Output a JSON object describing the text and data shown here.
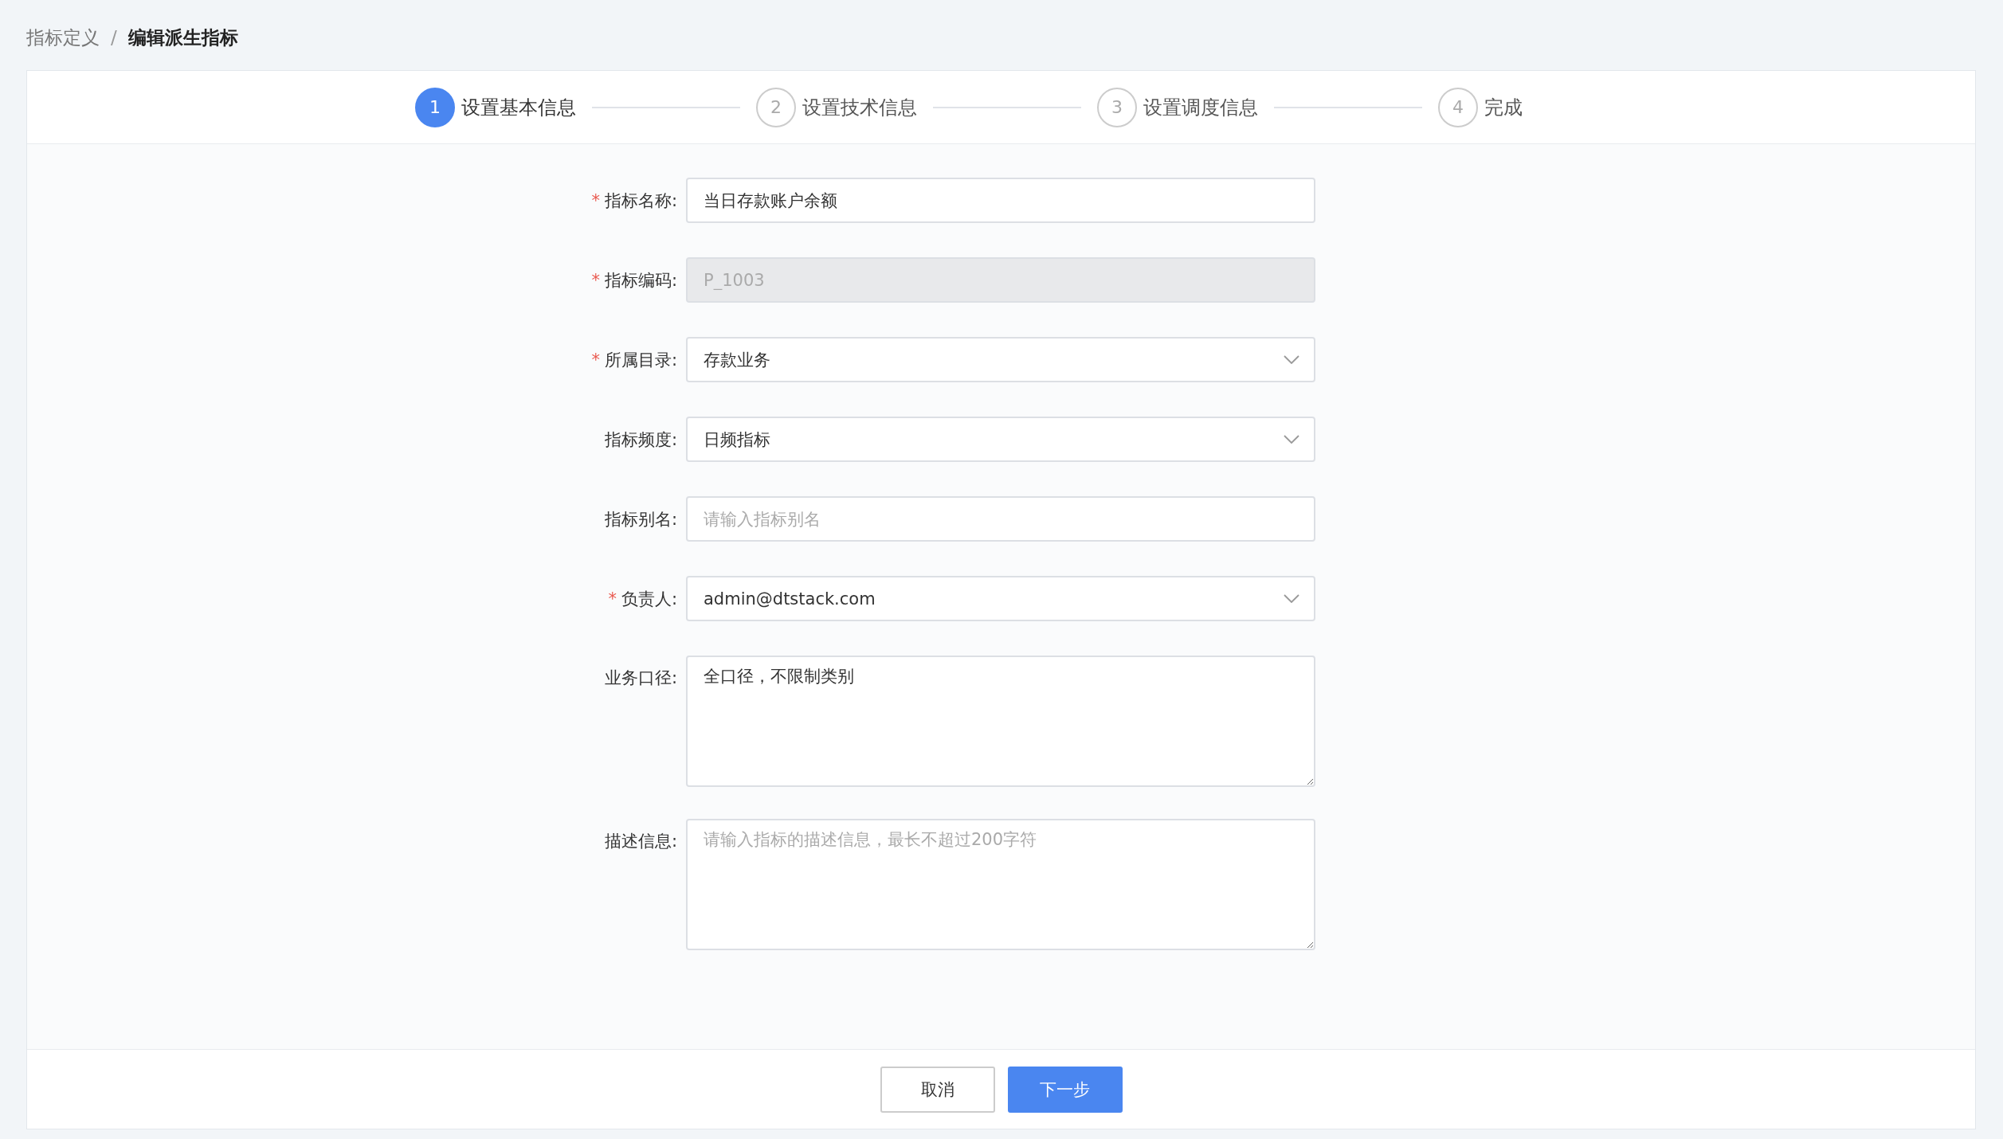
{
  "breadcrumb": [
    {
      "label": "指标定义",
      "current": false
    },
    {
      "label": "编辑派生指标",
      "current": true
    }
  ],
  "breadcrumb_separator": "/",
  "steps": [
    {
      "number": "1",
      "label": "设置基本信息",
      "active": true
    },
    {
      "number": "2",
      "label": "设置技术信息",
      "active": false
    },
    {
      "number": "3",
      "label": "设置调度信息",
      "active": false
    },
    {
      "number": "4",
      "label": "完成",
      "active": false
    }
  ],
  "form": [
    {
      "kind": "text",
      "label": "指标名称",
      "required": true,
      "value": "当日存款账户余额",
      "disabled": false
    },
    {
      "kind": "text",
      "label": "指标编码",
      "required": true,
      "value": "P_1003",
      "disabled": true
    },
    {
      "kind": "select",
      "label": "所属目录",
      "required": true,
      "value": "存款业务"
    },
    {
      "kind": "select",
      "label": "指标频度",
      "required": false,
      "value": "日频指标"
    },
    {
      "kind": "text",
      "label": "指标别名",
      "required": false,
      "placeholder": "请输入指标别名",
      "disabled": false
    },
    {
      "kind": "select",
      "label": "负责人",
      "required": true,
      "value": "admin@dtstack.com"
    },
    {
      "kind": "textarea",
      "label": "业务口径",
      "required": false,
      "value": "全口径，不限制类别"
    },
    {
      "kind": "textarea",
      "label": "描述信息",
      "required": false,
      "placeholder": "请输入指标的描述信息，最长不超过200字符"
    }
  ],
  "required_mark": "*",
  "label_suffix": ":",
  "buttons": [
    {
      "label": "取消",
      "kind": "default"
    },
    {
      "label": "下一步",
      "kind": "primary"
    }
  ]
}
